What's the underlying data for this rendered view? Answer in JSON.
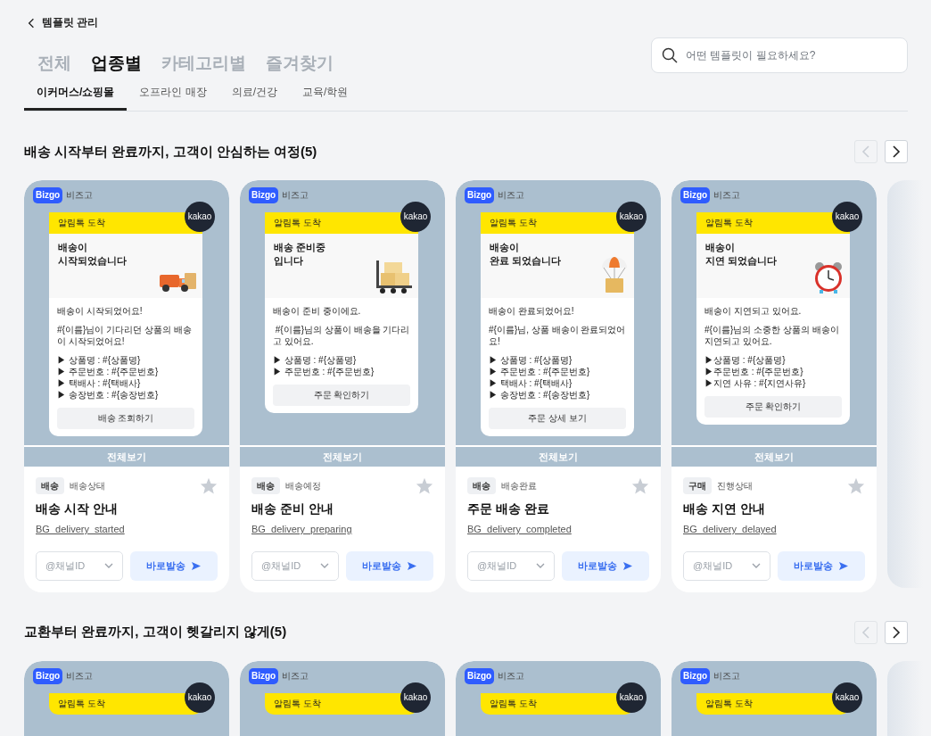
{
  "header": {
    "back_label": "템플릿 관리"
  },
  "tabs": [
    {
      "label": "전체",
      "selected": false
    },
    {
      "label": "업종별",
      "selected": true
    },
    {
      "label": "카테고리별",
      "selected": false
    },
    {
      "label": "즐겨찾기",
      "selected": false
    }
  ],
  "search": {
    "placeholder": "어떤 템플릿이 필요하세요?"
  },
  "subtabs": [
    {
      "label": "이커머스/쇼핑몰",
      "selected": true
    },
    {
      "label": "오프라인 매장",
      "selected": false
    },
    {
      "label": "의료/건강",
      "selected": false
    },
    {
      "label": "교육/학원",
      "selected": false
    }
  ],
  "sections": [
    {
      "title": "배송 시작부터 완료까지, 고객이 안심하는 여정(5)",
      "prev": {
        "disabled": true
      },
      "next": {
        "disabled": false
      },
      "peek_next": true,
      "cards": [
        {
          "logo": "Bizgo",
          "sender": "비즈고",
          "badge": "kakao",
          "bubble_header": "알림톡 도착",
          "bubble_title": "배송이\n시작되었습니다",
          "kind": "truck",
          "paragraphs": [
            "배송이 시작되었어요!",
            "#{이름}님이 기다리던 상품의 배송이 시작되었어요!"
          ],
          "items": [
            "▶ 상품명 : #{상품명}",
            "▶ 주문번호 : #{주문번호}",
            "▶ 택배사 : #{택배사}",
            "▶ 송장번호 : #{송장번호}"
          ],
          "action": "배송 조회하기",
          "view_all": "전체보기",
          "tag": "배송",
          "status": "배송상태",
          "starred": false,
          "name": "배송 시작 안내",
          "code": "BG_delivery_started",
          "channel_placeholder": "@채널ID",
          "send_label": "바로발송"
        },
        {
          "logo": "Bizgo",
          "sender": "비즈고",
          "badge": "kakao",
          "bubble_header": "알림톡 도착",
          "bubble_title": "배송 준비중\n입니다",
          "kind": "cart",
          "paragraphs": [
            "배송이 준비 중이에요.",
            " #{이름}님의 상품이 배송을 기다리고 있어요."
          ],
          "items": [
            "▶ 상품명 : #{상품명}",
            "▶ 주문번호 : #{주문번호}"
          ],
          "action": "주문 확인하기",
          "view_all": "전체보기",
          "tag": "배송",
          "status": "배송예정",
          "starred": false,
          "name": "배송 준비 안내",
          "code": "BG_delivery_preparing",
          "channel_placeholder": "@채널ID",
          "send_label": "바로발송"
        },
        {
          "logo": "Bizgo",
          "sender": "비즈고",
          "badge": "kakao",
          "bubble_header": "알림톡 도착",
          "bubble_title": "배송이\n완료 되었습니다",
          "kind": "parachute",
          "paragraphs": [
            "배송이 완료되었어요!",
            "#{이름}님, 상품 배송이 완료되었어요!"
          ],
          "items": [
            "▶ 상품명 : #{상품명}",
            "▶ 주문번호 : #{주문번호}",
            "▶ 택배사 : #{택배사}",
            "▶ 송장번호 : #{송장번호}"
          ],
          "action": "주문 상세 보기",
          "view_all": "전체보기",
          "tag": "배송",
          "status": "배송완료",
          "starred": false,
          "name": "주문 배송 완료",
          "code": "BG_delivery_completed",
          "channel_placeholder": "@채널ID",
          "send_label": "바로발송"
        },
        {
          "logo": "Bizgo",
          "sender": "비즈고",
          "badge": "kakao",
          "bubble_header": "알림톡 도착",
          "bubble_title": "배송이\n지연 되었습니다",
          "kind": "clock",
          "paragraphs": [
            "배송이 지연되고 있어요.",
            "#{이름}님의 소중한 상품의 배송이 지연되고 있어요."
          ],
          "items": [
            "▶상품명 : #{상품명}",
            "▶주문번호 : #{주문번호}",
            "▶지연 사유 : #{지연사유}"
          ],
          "action": "주문 확인하기",
          "view_all": "전체보기",
          "tag": "구매",
          "status": "진행상태",
          "starred": false,
          "name": "배송 지연 안내",
          "code": "BG_delivery_delayed",
          "channel_placeholder": "@채널ID",
          "send_label": "바로발송"
        }
      ]
    },
    {
      "title": "교환부터 완료까지, 고객이 헷갈리지 않게(5)",
      "prev": {
        "disabled": true
      },
      "next": {
        "disabled": false
      },
      "peek_next": true,
      "cards": [
        {
          "logo": "Bizgo",
          "sender": "비즈고",
          "badge": "kakao",
          "bubble_header": "알림톡 도착"
        },
        {
          "logo": "Bizgo",
          "sender": "비즈고",
          "badge": "kakao",
          "bubble_header": "알림톡 도착"
        },
        {
          "logo": "Bizgo",
          "sender": "비즈고",
          "badge": "kakao",
          "bubble_header": "알림톡 도착"
        },
        {
          "logo": "Bizgo",
          "sender": "비즈고",
          "badge": "kakao",
          "bubble_header": "알림톡 도착"
        }
      ]
    }
  ]
}
